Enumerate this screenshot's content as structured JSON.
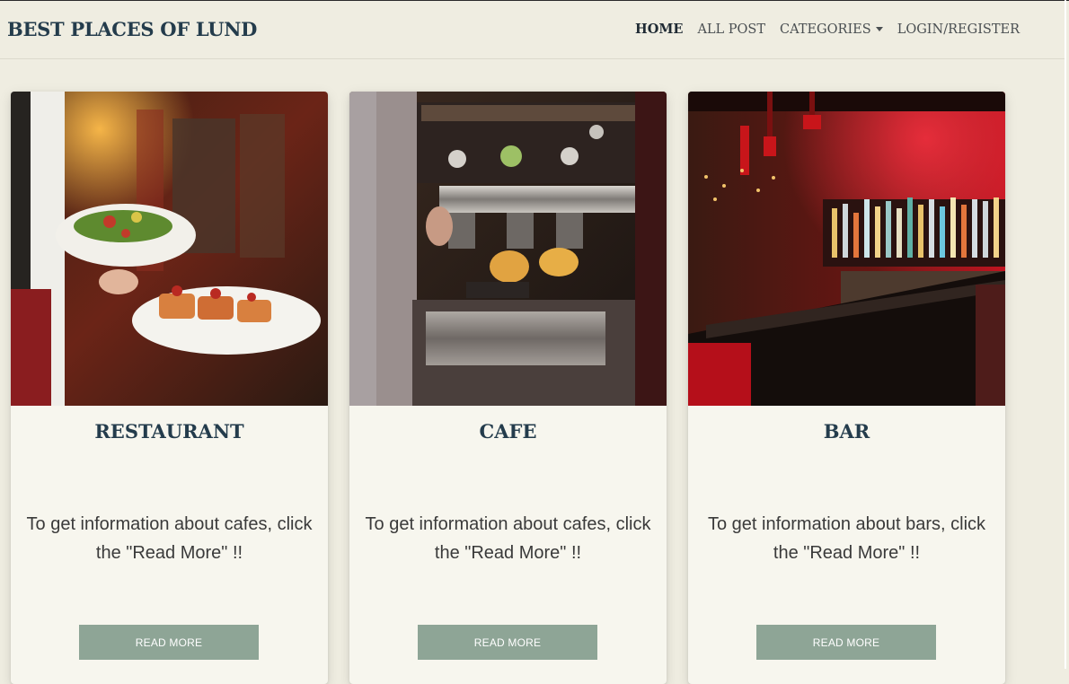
{
  "header": {
    "brand": "BEST PLACES OF LUND",
    "nav": [
      {
        "label": "HOME",
        "active": true
      },
      {
        "label": "ALL POST"
      },
      {
        "label": "CATEGORIES",
        "dropdown": true
      },
      {
        "label": "LOGIN/REGISTER"
      }
    ]
  },
  "cards": [
    {
      "title": "RESTAURANT",
      "text": "To get information about cafes, click the \"Read More\" !!",
      "button": "READ MORE",
      "image": "restaurant-photo"
    },
    {
      "title": "CAFE",
      "text": "To get information about cafes, click the \"Read More\" !!",
      "button": "READ MORE",
      "image": "cafe-photo"
    },
    {
      "title": "BAR",
      "text": "To get information about bars, click the \"Read More\" !!",
      "button": "READ MORE",
      "image": "bar-photo"
    }
  ],
  "colors": {
    "background": "#efede1",
    "brand": "#243c4c",
    "button": "#8ea596",
    "card": "#f7f6ee"
  }
}
